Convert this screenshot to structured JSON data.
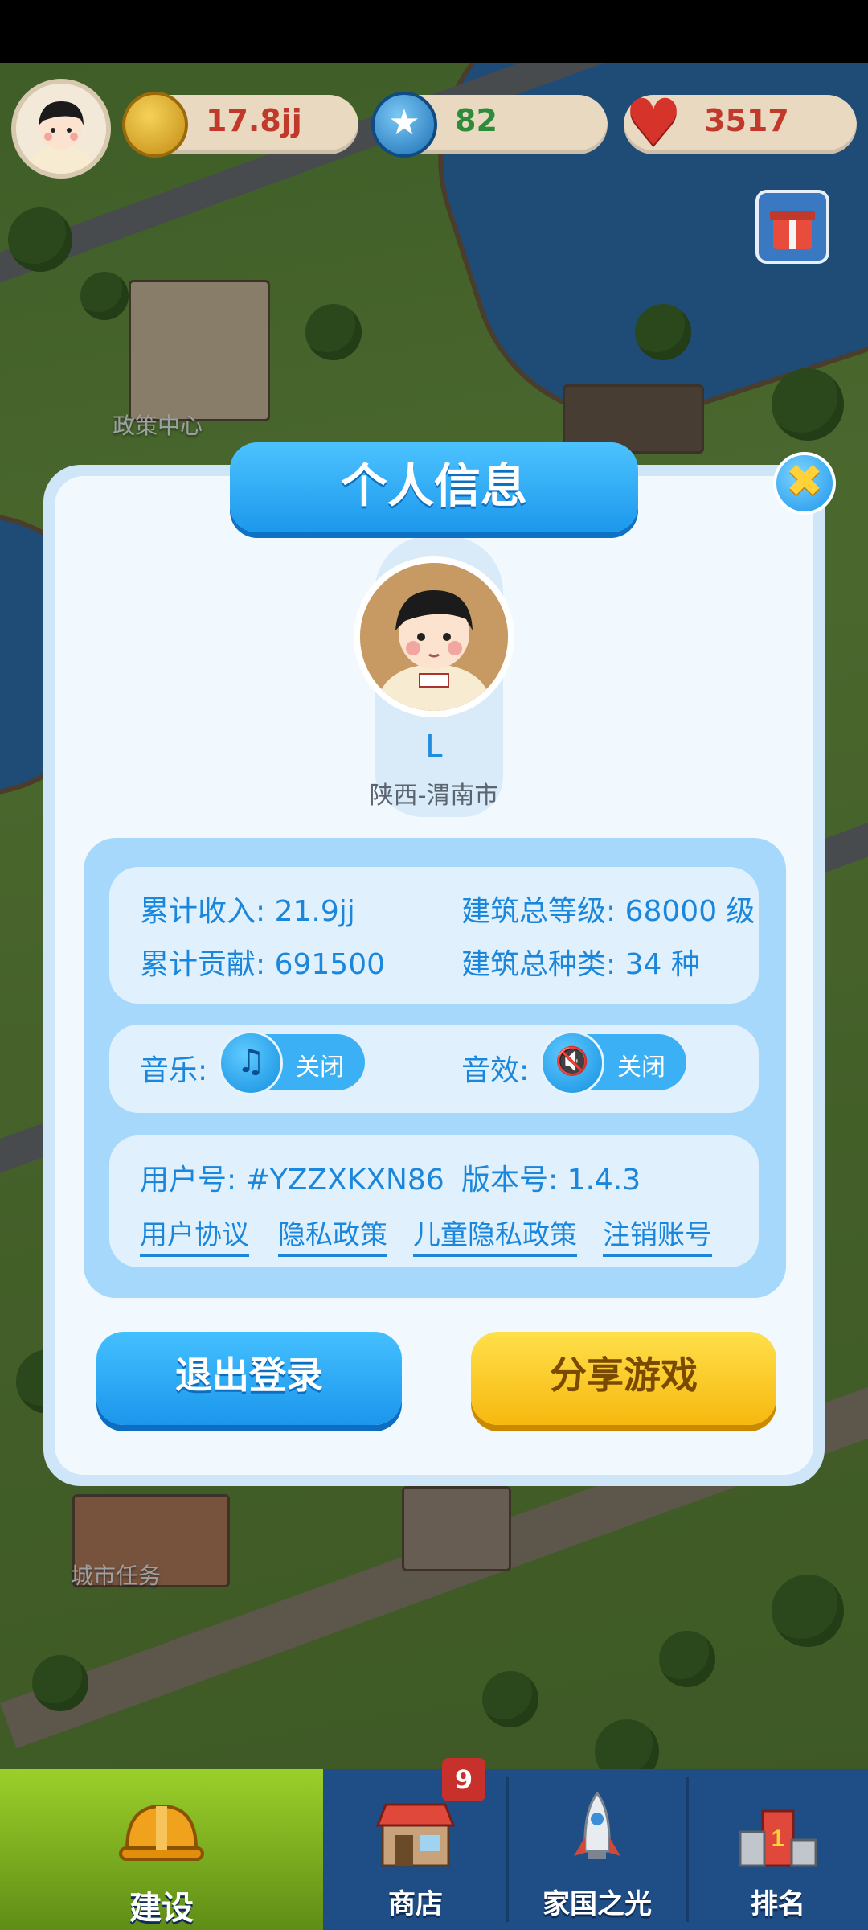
{
  "hud": {
    "coins": "17.8jj",
    "stars": "82",
    "hearts": "3517",
    "colors": {
      "coins": "#c0392b",
      "stars": "#2e8b3a",
      "hearts": "#c0392b"
    }
  },
  "map_labels": {
    "policy_center": "政策中心",
    "city_task": "城市任务"
  },
  "dialog": {
    "title": "个人信息",
    "name": "L",
    "location": "陕西-渭南市",
    "stats": {
      "income": "累计收入: 21.9jj",
      "contribution": "累计贡献: 691500",
      "building_level": "建筑总等级: 68000 级",
      "building_types": "建筑总种类: 34 种"
    },
    "settings": {
      "music_label": "音乐:",
      "music_state": "关闭",
      "sfx_label": "音效:",
      "sfx_state": "关闭"
    },
    "account": {
      "user_id": "用户号: #YZZXKXN86",
      "version": "版本号: 1.4.3",
      "links": [
        "用户协议",
        "隐私政策",
        "儿童隐私政策",
        "注销账号"
      ]
    },
    "buttons": {
      "logout": "退出登录",
      "share": "分享游戏"
    }
  },
  "nav": {
    "items": [
      {
        "label": "建设",
        "active": true,
        "icon": "hard-hat-icon"
      },
      {
        "label": "商店",
        "badge": "9",
        "icon": "shop-icon"
      },
      {
        "label": "家国之光",
        "icon": "rocket-icon"
      },
      {
        "label": "排名",
        "icon": "ranking-icon"
      }
    ]
  }
}
